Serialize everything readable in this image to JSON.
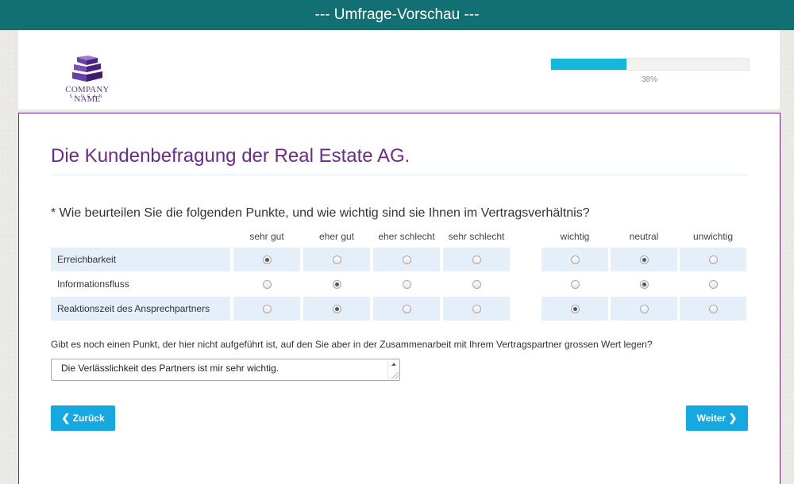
{
  "topbar": {
    "title": "--- Umfrage-Vorschau ---"
  },
  "logo": {
    "name": "COMPANY NAME",
    "slogan": "SLOGAN",
    "color": "#5d3b8a"
  },
  "progress": {
    "value": 38,
    "label": "38%",
    "color": "#14b8d8"
  },
  "survey": {
    "title": "Die Kundenbefragung der Real Estate AG.",
    "question": "* Wie beurteilen Sie die folgenden Punkte, und wie wichtig sind sie Ihnen im Vertragsverhältnis?",
    "rating_columns": [
      "sehr gut",
      "eher gut",
      "eher schlecht",
      "sehr schlecht"
    ],
    "importance_columns": [
      "wichtig",
      "neutral",
      "unwichtig"
    ],
    "rows": [
      {
        "label": "Erreichbarkeit",
        "rating": 0,
        "importance": 1
      },
      {
        "label": "Informationsfluss",
        "rating": 1,
        "importance": 1
      },
      {
        "label": "Reaktionszeit des Ansprechpartners",
        "rating": 1,
        "importance": 0
      }
    ],
    "open_question": "Gibt es noch einen Punkt, der hier nicht aufgeführt ist, auf den Sie aber in der Zusammenarbeit mit Ihrem Vertragspartner grossen Wert legen?",
    "open_answer": "Die Verlässlichkeit des Partners ist mir sehr wichtig."
  },
  "nav": {
    "back_label": "Zurück",
    "next_label": "Weiter",
    "back_icon": "chevron-left-icon",
    "next_icon": "chevron-right-icon",
    "button_color": "#16a8e0"
  },
  "colors": {
    "topbar": "#137072",
    "accent": "#6d2a8a",
    "row_shade": "#e4eff9"
  }
}
